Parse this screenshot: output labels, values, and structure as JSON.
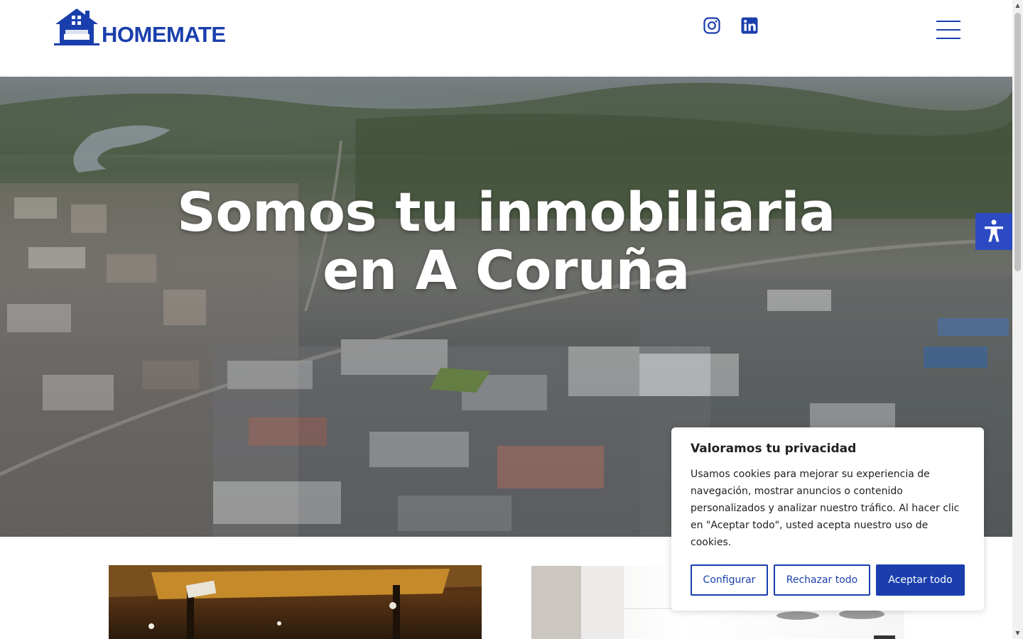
{
  "header": {
    "brand": "HOMEMATE",
    "brand_color": "#1a3fad",
    "social": [
      {
        "icon": "instagram-icon"
      },
      {
        "icon": "linkedin-icon"
      }
    ],
    "menu_icon": "hamburger-menu-icon"
  },
  "hero": {
    "title_line1": "Somos tu inmobiliaria",
    "title_line2": "en A Coruña",
    "background": "aerial-city-photo"
  },
  "accessibility": {
    "icon": "accessibility-icon",
    "color": "#2c4bc2"
  },
  "cookie_banner": {
    "title": "Valoramos tu privacidad",
    "text": "Usamos cookies para mejorar su experiencia de navegación, mostrar anuncios o contenido personalizados y analizar nuestro tráfico. Al hacer clic en \"Aceptar todo\", usted acepta nuestro uso de cookies.",
    "buttons": {
      "configure": "Configurar",
      "reject": "Rechazar todo",
      "accept": "Aceptar todo"
    },
    "accent_color": "#1a3fad"
  }
}
